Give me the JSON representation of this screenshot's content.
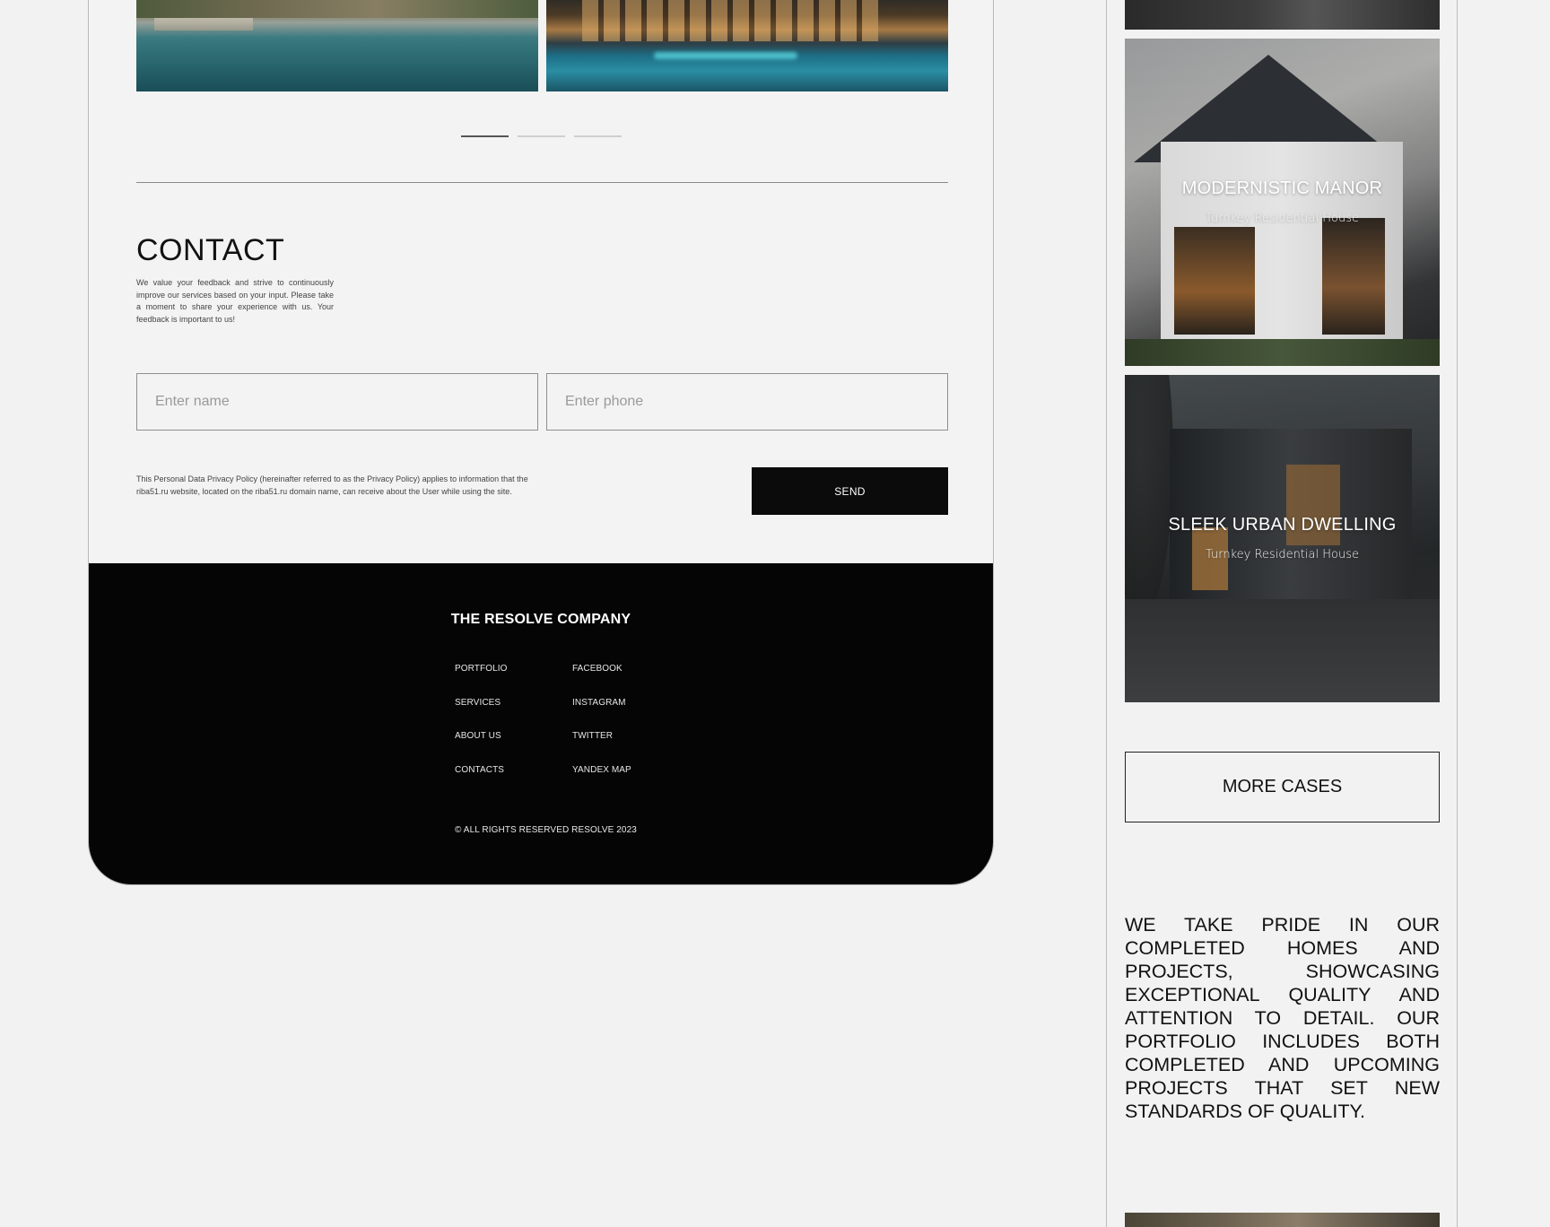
{
  "contact": {
    "title": "CONTACT",
    "description": "We value your feedback and strive to continuously improve our services based on your input. Please take a moment to share your experience with us. Your feedback is important to us!",
    "name_placeholder": "Enter name",
    "phone_placeholder": "Enter phone",
    "policy": "This Personal Data Privacy Policy (hereinafter referred to as the Privacy Policy) applies to information that the riba51.ru website, located on the riba51.ru domain name, can receive about the User while using the site.",
    "send_label": "SEND"
  },
  "slider": {
    "total": 3,
    "active": 1
  },
  "footer": {
    "brand": "THE RESOLVE COMPANY",
    "nav": [
      "PORTFOLIO",
      "SERVICES",
      "ABOUT US",
      "CONTACTS"
    ],
    "social": [
      "FACEBOOK",
      "INSTAGRAM",
      "TWITTER",
      "YANDEX MAP"
    ],
    "copyright": "© ALL RIGHTS RESERVED RESOLVE 2023"
  },
  "cases": [
    {
      "title": "MODERNISTIC MANOR",
      "subtitle": "Turnkey Residential House"
    },
    {
      "title": "SLEEK URBAN DWELLING",
      "subtitle": "Turnkey Residential House"
    }
  ],
  "more_cases_label": "MORE CASES",
  "pride_text": "We take pride in our completed homes and projects, showcasing exceptional quality and attention to detail. Our portfolio includes both completed and upcoming projects that set new standards of quality.",
  "colors": {
    "footer_bg": "#050505",
    "button_bg": "#0b0b0b",
    "page_bg": "#f2f2f2"
  }
}
